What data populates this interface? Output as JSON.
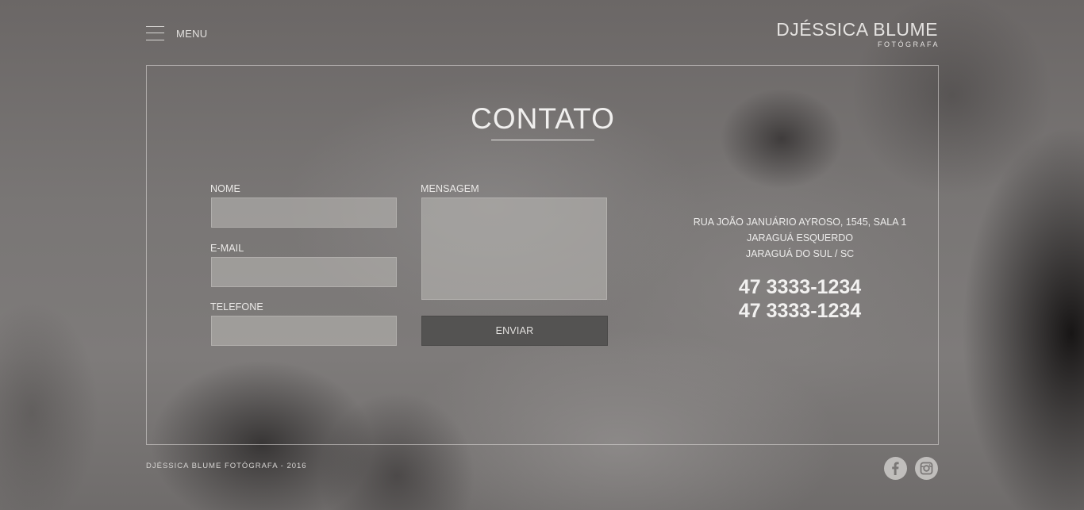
{
  "header": {
    "menu_label": "MENU",
    "logo_name": "DJÉSSICA BLUME",
    "logo_subtitle": "FOTÓGRAFA"
  },
  "contact": {
    "title": "CONTATO",
    "form": {
      "name_label": "NOME",
      "email_label": "E-MAIL",
      "phone_label": "TELEFONE",
      "message_label": "MENSAGEM",
      "name_value": "",
      "email_value": "",
      "phone_value": "",
      "message_value": "",
      "submit_label": "ENVIAR"
    },
    "address": {
      "line1": "RUA JOÃO JANUÁRIO AYROSO, 1545, SALA 1",
      "line2": "JARAGUÁ ESQUERDO",
      "line3": "JARAGUÁ DO SUL / SC"
    },
    "phones": [
      "47 3333-1234",
      "47 3333-1234"
    ]
  },
  "footer": {
    "copyright": "DJÉSSICA BLUME FOTÓGRAFA - 2016",
    "social": [
      {
        "name": "facebook",
        "icon": "facebook-icon"
      },
      {
        "name": "instagram",
        "icon": "instagram-icon"
      }
    ]
  },
  "colors": {
    "background": "#7a7776",
    "field_fill": "#a9a6a4",
    "button_fill": "#545352",
    "text": "#ecebea"
  }
}
